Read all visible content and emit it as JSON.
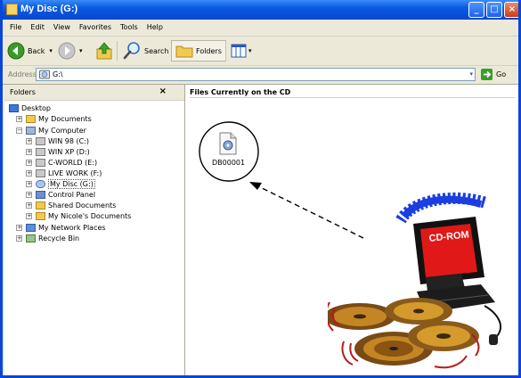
{
  "window": {
    "title": "My Disc (G:)"
  },
  "menu": [
    "File",
    "Edit",
    "View",
    "Favorites",
    "Tools",
    "Help"
  ],
  "toolbar": {
    "back": "Back",
    "search": "Search",
    "folders": "Folders"
  },
  "address": {
    "label": "Address",
    "value": "G:\\",
    "go": "Go"
  },
  "folders_pane": {
    "title": "Folders",
    "close": "×",
    "items": [
      "Desktop",
      "My Documents",
      "My Computer",
      "WIN 98 (C:)",
      "WIN XP (D:)",
      "C-WORLD (E:)",
      "LIVE WORK (F:)",
      "My Disc (G:)",
      "Control Panel",
      "Shared Documents",
      "My Nicole's Documents",
      "My Network Places",
      "Recycle Bin"
    ]
  },
  "content": {
    "header": "Files Currently on the CD",
    "file_label": "DB00001",
    "clipart_label": "CD-ROM"
  },
  "colors": {
    "title_bar": "#0548d1",
    "accent": "#316ac5",
    "clipart_blue": "#1a3ee0",
    "clipart_red": "#e01818"
  }
}
